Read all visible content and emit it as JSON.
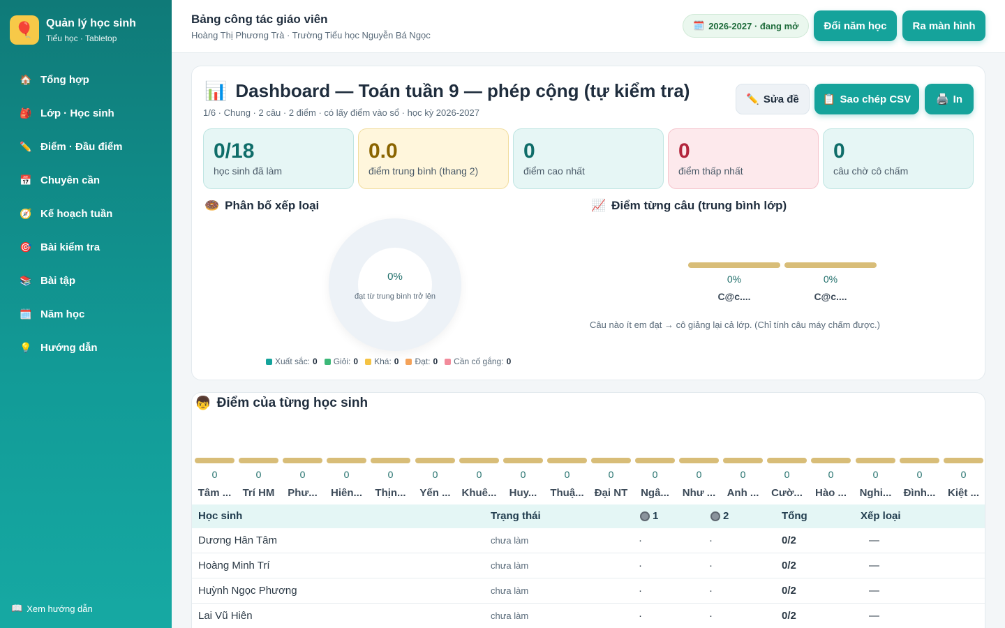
{
  "sidebar": {
    "brand_title": "Quản lý học sinh",
    "brand_sub": "Tiểu học · Tabletop",
    "items": [
      {
        "label": "Tổng hợp",
        "icon": "🏠"
      },
      {
        "label": "Lớp · Học sinh",
        "icon": "🎒"
      },
      {
        "label": "Điểm · Đầu điểm",
        "icon": "✏️"
      },
      {
        "label": "Chuyên cần",
        "icon": "📅"
      },
      {
        "label": "Kế hoạch tuần",
        "icon": "🧭"
      },
      {
        "label": "Bài kiểm tra",
        "icon": "🎯"
      },
      {
        "label": "Bài tập",
        "icon": "📚"
      },
      {
        "label": "Năm học",
        "icon": "🗓️"
      },
      {
        "label": "Hướng dẫn",
        "icon": "💡"
      }
    ],
    "footer": "Xem hướng dẫn"
  },
  "topbar": {
    "title": "Bảng công tác giáo viên",
    "subtitle": "Hoàng Thị Phương Trà · Trường Tiểu học Nguyễn Bá Ngọc",
    "year_pill": "2026-2027 · đang mở",
    "change_year": "Đổi năm học",
    "exit_screen": "Ra màn hình"
  },
  "dashboard": {
    "title": "Dashboard — Toán tuần 9 — phép cộng (tự kiểm tra)",
    "subtitle": "1/6 · Chung · 2 câu · 2 điểm · có lấy điểm vào sổ · học kỳ 2026-2027",
    "edit": "Sửa đề",
    "copy_csv": "Sao chép CSV",
    "print": "In",
    "stats": [
      {
        "value": "0/18",
        "label": "học sinh đã làm"
      },
      {
        "value": "0.0",
        "label": "điểm trung bình (thang 2)"
      },
      {
        "value": "0",
        "label": "điểm cao nhất"
      },
      {
        "value": "0",
        "label": "điểm thấp nhất"
      },
      {
        "value": "0",
        "label": "câu chờ cô chấm"
      }
    ],
    "dist_title": "Phân bố xếp loại",
    "donut_pct": "0%",
    "donut_caption": "đạt từ trung bình trở lên",
    "legend": [
      {
        "label": "Xuất sắc:",
        "count": "0",
        "color": "#14a39b"
      },
      {
        "label": "Giỏi:",
        "count": "0",
        "color": "#3cb878"
      },
      {
        "label": "Khá:",
        "count": "0",
        "color": "#f5c343"
      },
      {
        "label": "Đạt:",
        "count": "0",
        "color": "#f4a259"
      },
      {
        "label": "Cần cố gắng:",
        "count": "0",
        "color": "#f28b9b"
      }
    ],
    "q_title": "Điểm từng câu (trung bình lớp)",
    "q_bars": [
      {
        "value": "0%",
        "label": "C@c...."
      },
      {
        "value": "0%",
        "label": "C@c...."
      }
    ],
    "q_note": "Câu nào ít em đạt → cô giảng lại cả lớp. (Chỉ tính câu máy chấm được.)"
  },
  "students_section": {
    "title": "Điểm của từng học sinh",
    "bars": [
      {
        "value": "0",
        "label": "Tâm ..."
      },
      {
        "value": "0",
        "label": "Trí HM"
      },
      {
        "value": "0",
        "label": "Phư..."
      },
      {
        "value": "0",
        "label": "Hiên..."
      },
      {
        "value": "0",
        "label": "Thịn..."
      },
      {
        "value": "0",
        "label": "Yến ..."
      },
      {
        "value": "0",
        "label": "Khuê..."
      },
      {
        "value": "0",
        "label": "Huy..."
      },
      {
        "value": "0",
        "label": "Thuậ..."
      },
      {
        "value": "0",
        "label": "Đại NT"
      },
      {
        "value": "0",
        "label": "Ngâ..."
      },
      {
        "value": "0",
        "label": "Như ..."
      },
      {
        "value": "0",
        "label": "Anh ..."
      },
      {
        "value": "0",
        "label": "Cườ..."
      },
      {
        "value": "0",
        "label": "Hào ..."
      },
      {
        "value": "0",
        "label": "Nghi..."
      },
      {
        "value": "0",
        "label": "Đình..."
      },
      {
        "value": "0",
        "label": "Kiệt ..."
      }
    ],
    "headers": {
      "student": "Học sinh",
      "status": "Trạng thái",
      "q1": "1",
      "q2": "2",
      "total": "Tổng",
      "rank": "Xếp loại"
    },
    "rows": [
      {
        "name": "Dương Hân Tâm",
        "status": "chưa làm",
        "q1": "·",
        "q2": "·",
        "total": "0/2",
        "rank": "—"
      },
      {
        "name": "Hoàng Minh Trí",
        "status": "chưa làm",
        "q1": "·",
        "q2": "·",
        "total": "0/2",
        "rank": "—"
      },
      {
        "name": "Huỳnh Ngọc Phương",
        "status": "chưa làm",
        "q1": "·",
        "q2": "·",
        "total": "0/2",
        "rank": "—"
      },
      {
        "name": "Lai Vũ Hiên",
        "status": "chưa làm",
        "q1": "·",
        "q2": "·",
        "total": "0/2",
        "rank": "—"
      }
    ]
  },
  "colors": {
    "teal": "#15a39b",
    "bar_gold": "#d8bd78",
    "stat_teal_bg": "#e6f6f5",
    "stat_yellow_bg": "#fff6dc",
    "stat_pink_bg": "#fde9ec"
  }
}
